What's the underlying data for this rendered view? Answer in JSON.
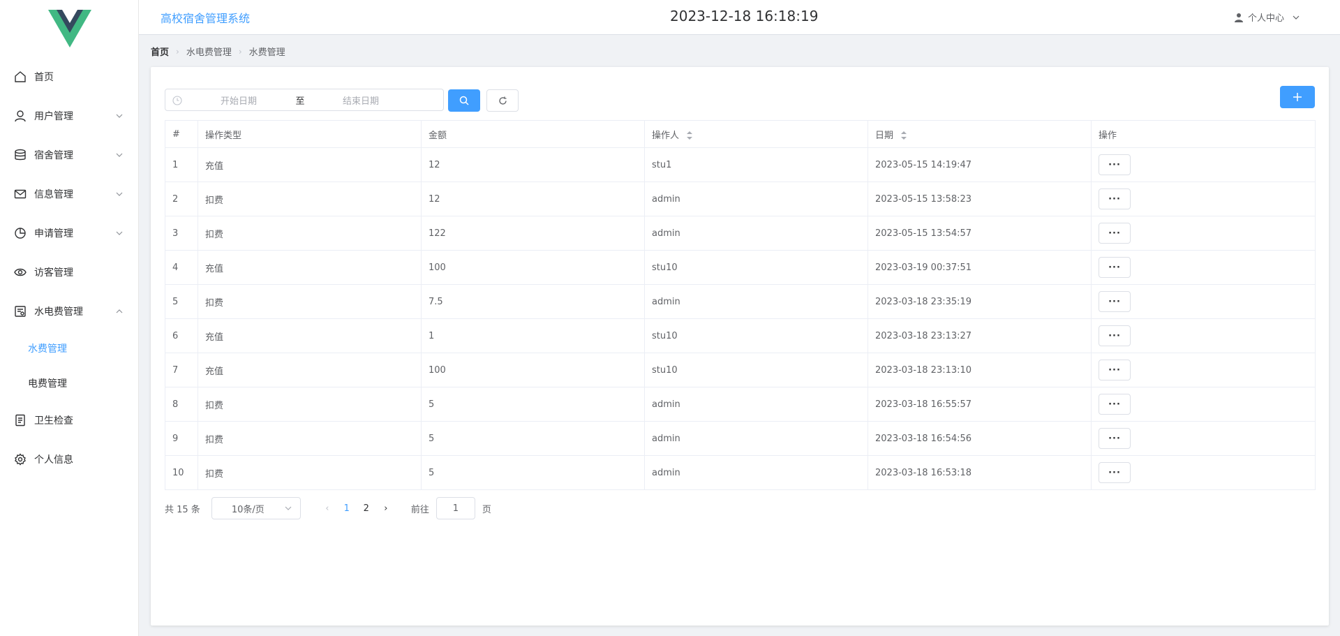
{
  "header": {
    "system_title": "高校宿舍管理系统",
    "datetime": "2023-12-18 16:18:19",
    "user_center": "个人中心"
  },
  "sidebar": {
    "items": [
      {
        "label": "首页",
        "icon": "home-icon"
      },
      {
        "label": "用户管理",
        "icon": "user-icon",
        "expandable": true
      },
      {
        "label": "宿舍管理",
        "icon": "database-icon",
        "expandable": true
      },
      {
        "label": "信息管理",
        "icon": "mail-icon",
        "expandable": true
      },
      {
        "label": "申请管理",
        "icon": "pie-chart-icon",
        "expandable": true
      },
      {
        "label": "访客管理",
        "icon": "eye-icon"
      },
      {
        "label": "水电费管理",
        "icon": "bill-icon",
        "expanded": true,
        "children": [
          {
            "label": "水费管理",
            "active": true
          },
          {
            "label": "电费管理"
          }
        ]
      },
      {
        "label": "卫生检查",
        "icon": "document-icon"
      },
      {
        "label": "个人信息",
        "icon": "gear-icon"
      }
    ]
  },
  "breadcrumb": [
    "首页",
    "水电费管理",
    "水费管理"
  ],
  "filters": {
    "start_placeholder": "开始日期",
    "range_separator": "至",
    "end_placeholder": "结束日期"
  },
  "table": {
    "columns": [
      "#",
      "操作类型",
      "金额",
      "操作人",
      "日期",
      "操作"
    ],
    "rows": [
      {
        "index": "1",
        "type": "充值",
        "amount": "12",
        "operator": "stu1",
        "date": "2023-05-15 14:19:47"
      },
      {
        "index": "2",
        "type": "扣费",
        "amount": "12",
        "operator": "admin",
        "date": "2023-05-15 13:58:23"
      },
      {
        "index": "3",
        "type": "扣费",
        "amount": "122",
        "operator": "admin",
        "date": "2023-05-15 13:54:57"
      },
      {
        "index": "4",
        "type": "充值",
        "amount": "100",
        "operator": "stu10",
        "date": "2023-03-19 00:37:51"
      },
      {
        "index": "5",
        "type": "扣费",
        "amount": "7.5",
        "operator": "admin",
        "date": "2023-03-18 23:35:19"
      },
      {
        "index": "6",
        "type": "充值",
        "amount": "1",
        "operator": "stu10",
        "date": "2023-03-18 23:13:27"
      },
      {
        "index": "7",
        "type": "充值",
        "amount": "100",
        "operator": "stu10",
        "date": "2023-03-18 23:13:10"
      },
      {
        "index": "8",
        "type": "扣费",
        "amount": "5",
        "operator": "admin",
        "date": "2023-03-18 16:55:57"
      },
      {
        "index": "9",
        "type": "扣费",
        "amount": "5",
        "operator": "admin",
        "date": "2023-03-18 16:54:56"
      },
      {
        "index": "10",
        "type": "扣费",
        "amount": "5",
        "operator": "admin",
        "date": "2023-03-18 16:53:18"
      }
    ],
    "action_label": "···"
  },
  "pagination": {
    "total_text": "共 15 条",
    "page_size": "10条/页",
    "pages": [
      "1",
      "2"
    ],
    "current_page": "1",
    "goto_label": "前往",
    "goto_value": "1",
    "goto_suffix": "页"
  },
  "colors": {
    "accent": "#409eff",
    "logo_green": "#41b883",
    "logo_dark": "#34495e"
  }
}
